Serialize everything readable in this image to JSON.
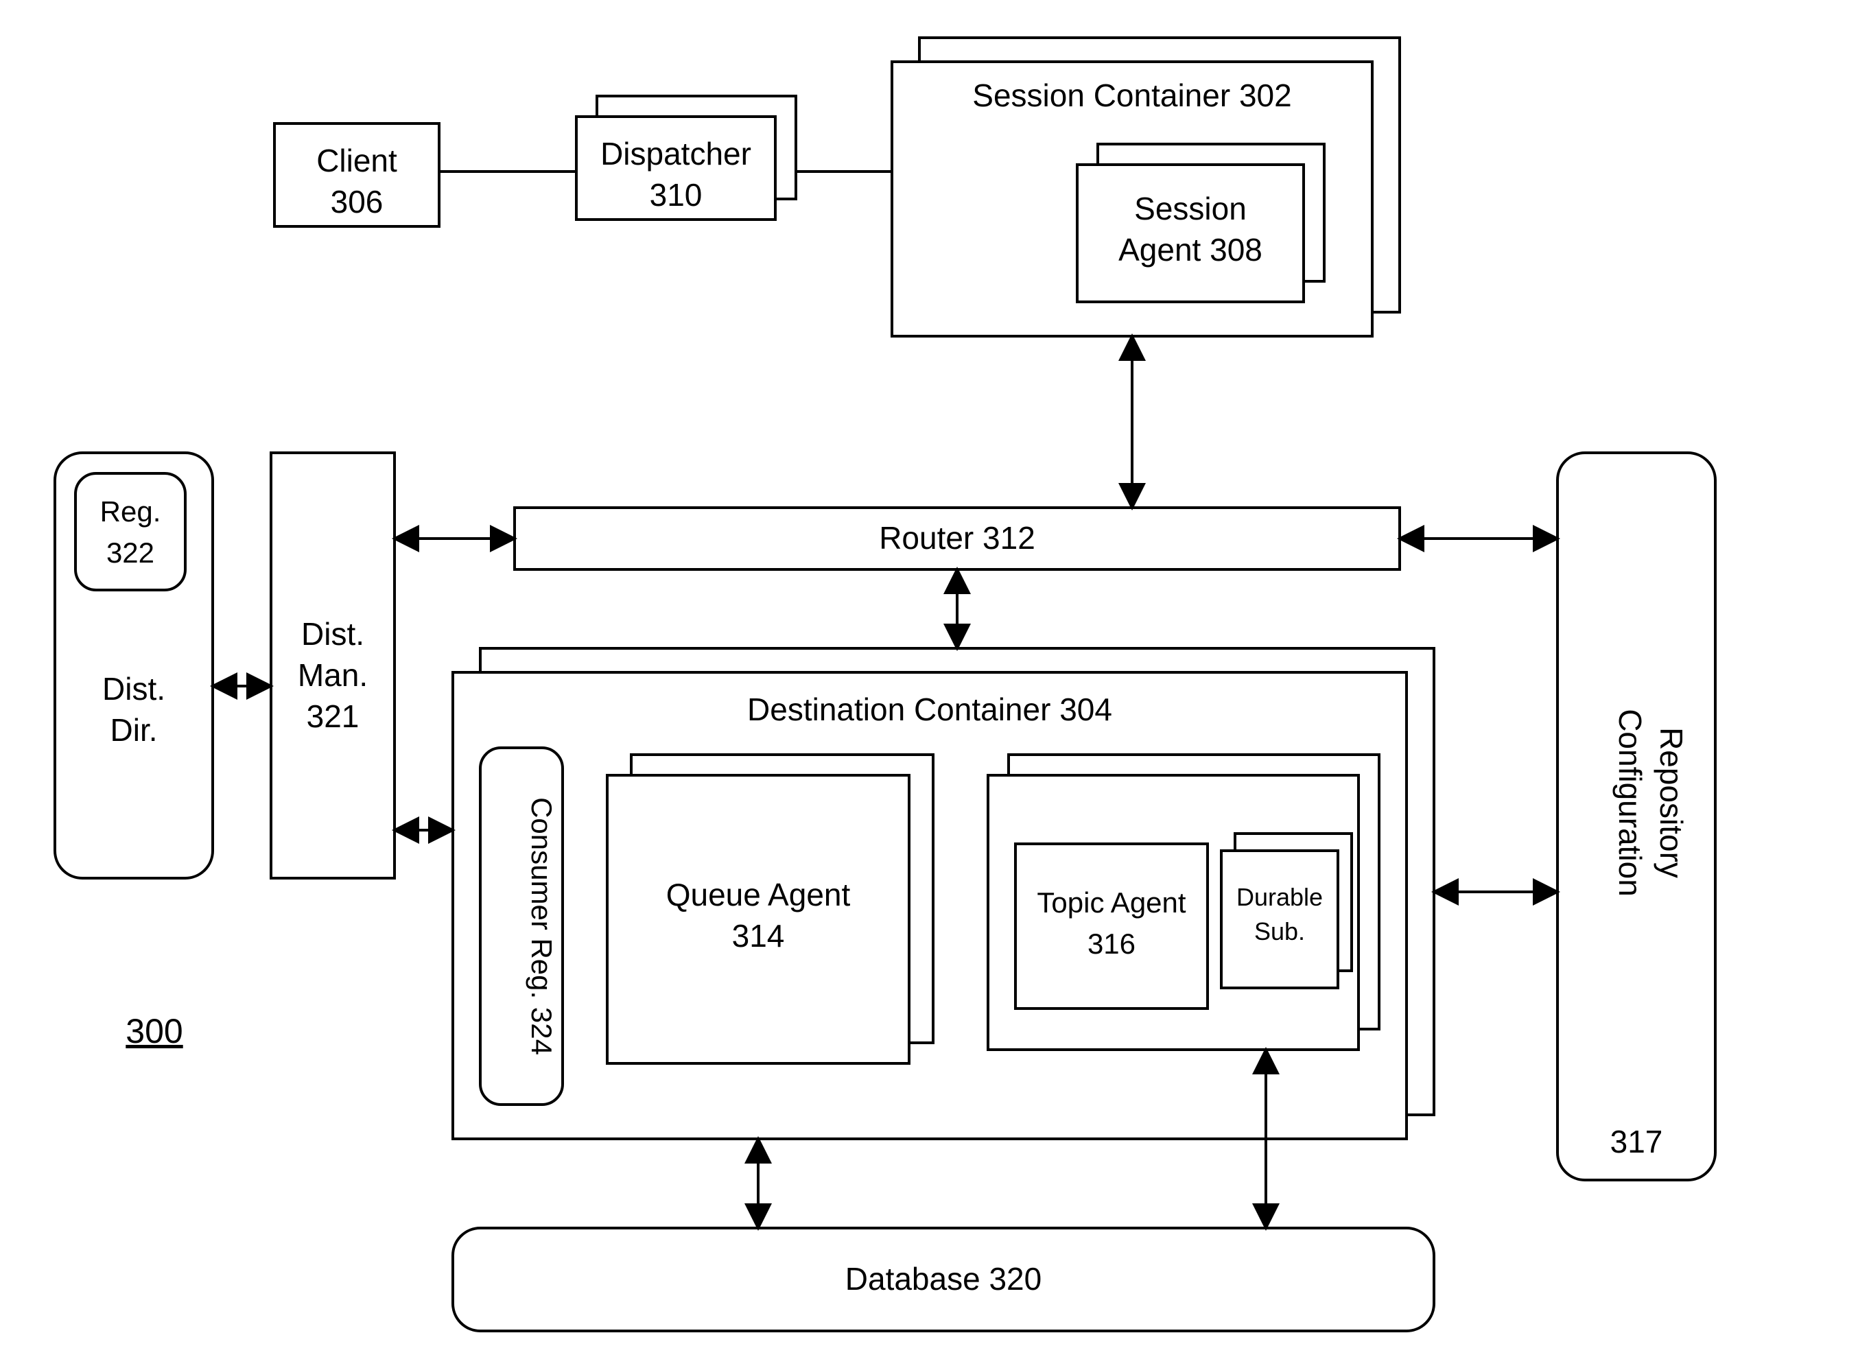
{
  "diagram": {
    "figure_number": "300",
    "client": {
      "line1": "Client",
      "line2": "306"
    },
    "dispatcher": {
      "line1": "Dispatcher",
      "line2": "310"
    },
    "session_container": {
      "label": "Session Container 302"
    },
    "session_agent": {
      "line1": "Session",
      "line2": "Agent 308"
    },
    "router": {
      "label": "Router 312"
    },
    "dist_dir": {
      "line1": "Dist.",
      "line2": "Dir."
    },
    "reg": {
      "line1": "Reg.",
      "line2": "322"
    },
    "dist_man": {
      "line1": "Dist.",
      "line2": "Man.",
      "line3": "321"
    },
    "destination_container": {
      "label": "Destination Container 304"
    },
    "consumer_reg": {
      "label": "Consumer Reg. 324"
    },
    "queue_agent": {
      "line1": "Queue Agent",
      "line2": "314"
    },
    "topic_agent": {
      "line1": "Topic Agent",
      "line2": "316"
    },
    "durable_sub": {
      "line1": "Durable",
      "line2": "Sub."
    },
    "config_repo": {
      "line1": "Configuration",
      "line2": "Repository",
      "line3": "317"
    },
    "database": {
      "label": "Database 320"
    }
  }
}
